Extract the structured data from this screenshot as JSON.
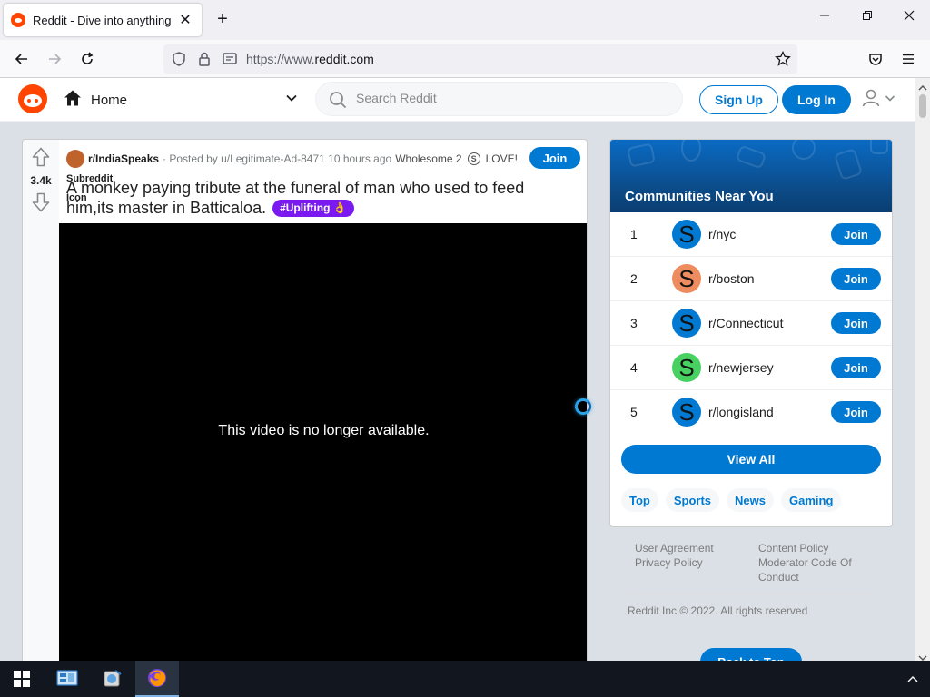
{
  "browser": {
    "tab_title": "Reddit - Dive into anything",
    "url_prefix": "https://www.",
    "url_domain": "reddit.com",
    "colors": {
      "tab_bg": "#f0f0f4",
      "url_bg": "#f0f0f4"
    }
  },
  "header": {
    "feed_label": "Home",
    "search_placeholder": "Search Reddit",
    "signup_label": "Sign Up",
    "login_label": "Log In",
    "colors": {
      "brand": "#ff4500",
      "accent": "#0079d3"
    }
  },
  "post": {
    "vote_count": "3.4k",
    "subreddit_icon_alt": "Subreddit Icon",
    "subreddit": "r/IndiaSpeaks",
    "posted_by": "· Posted by u/Legitimate-Ad-8471 10 hours ago",
    "award_wholesome": "Wholesome 2",
    "award_love": "LOVE!",
    "join_label": "Join",
    "title": "A monkey paying tribute at the funeral of man who used to feed him,its master in Batticaloa.",
    "flair": "#Uplifting 👌",
    "video_message": "This video is no longer available."
  },
  "sidebar": {
    "title": "Communities Near You",
    "communities": [
      {
        "rank": "1",
        "avatar_letter": "S",
        "name": "r/nyc",
        "join": "Join",
        "color": "#0079d3"
      },
      {
        "rank": "2",
        "avatar_letter": "S",
        "name": "r/boston",
        "join": "Join",
        "color": "#ee8c5f"
      },
      {
        "rank": "3",
        "avatar_letter": "S",
        "name": "r/Connecticut",
        "join": "Join",
        "color": "#0079d3"
      },
      {
        "rank": "4",
        "avatar_letter": "S",
        "name": "r/newjersey",
        "join": "Join",
        "color": "#46d160"
      },
      {
        "rank": "5",
        "avatar_letter": "S",
        "name": "r/longisland",
        "join": "Join",
        "color": "#0079d3"
      }
    ],
    "view_all": "View All",
    "tags": [
      "Top",
      "Sports",
      "News",
      "Gaming"
    ]
  },
  "footer": {
    "user_agreement": "User Agreement",
    "privacy_policy": "Privacy Policy",
    "content_policy": "Content Policy",
    "moderator_code": "Moderator Code Of Conduct",
    "copyright": "Reddit Inc © 2022. All rights reserved",
    "back_to_top": "Back to Top"
  }
}
